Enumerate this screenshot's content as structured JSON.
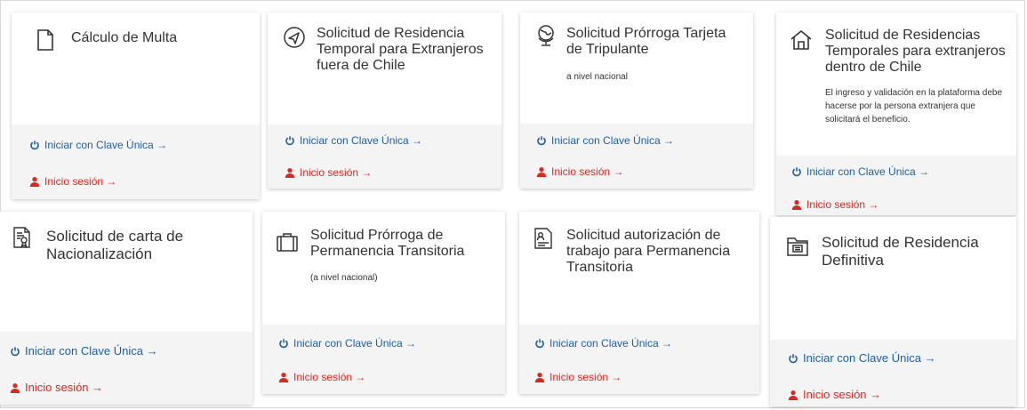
{
  "colors": {
    "clave_link": "#1e5fa8",
    "sesion_link": "#e0261c",
    "title_text": "#333333",
    "footer_bg": "#f4f4f4"
  },
  "cards": [
    {
      "title": "Cálculo de Multa",
      "icon": "document-icon",
      "note": "",
      "clave": "Iniciar con Clave Única →",
      "sesion": "Inicio sesión →"
    },
    {
      "title": "Solicitud de Residencia Temporal para Extranjeros fuera de Chile",
      "icon": "compass-arrow-icon",
      "note": "",
      "clave": "Iniciar con Clave Única →",
      "sesion": "Inicio sesión →"
    },
    {
      "title": "Solicitud Prórroga Tarjeta de Tripulante",
      "icon": "globe-icon",
      "note": "a nivel nacional",
      "clave": "Iniciar con Clave Única →",
      "sesion": "Inicio sesión →"
    },
    {
      "title": "Solicitud de Residencias Temporales para extranjeros dentro de Chile",
      "icon": "house-icon",
      "note": "El ingreso y validación en la plataforma debe hacerse por la persona extranjera que solicitará el beneficio.",
      "clave": "Iniciar con Clave Única →",
      "sesion": "Inicio sesión →"
    },
    {
      "title": "Solicitud de carta de Nacionalización",
      "icon": "certificate-icon",
      "note": "",
      "clave": "Iniciar con Clave Única →",
      "sesion": "Inicio sesión →"
    },
    {
      "title": "Solicitud Prórroga de Permanencia Transitoria",
      "icon": "suitcase-icon",
      "note": "(a nivel nacional)",
      "clave": "Iniciar con Clave Única →",
      "sesion": "Inicio sesión →"
    },
    {
      "title": "Solicitud autorización de trabajo para Permanencia Transitoria",
      "icon": "id-document-icon",
      "note": "",
      "clave": "Iniciar con Clave Única →",
      "sesion": "Inicio sesión →"
    },
    {
      "title": "Solicitud de Residencia Definitiva",
      "icon": "folder-icon",
      "note": "",
      "clave": "Iniciar con Clave Única →",
      "sesion": "Inicio sesión →"
    }
  ]
}
